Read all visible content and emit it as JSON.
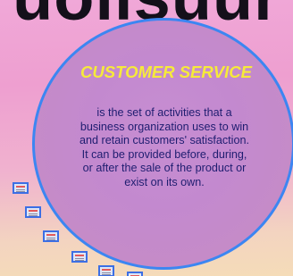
{
  "slide": {
    "heading_partial": "uolisuur",
    "title": "CUSTOMER SERVICE",
    "body_lines": [
      "is the set of activities that a",
      "business organization uses to win",
      "and retain customers' satisfaction.",
      "It can be provided before, during,",
      "or after the sale of the product or",
      "exist on its own."
    ]
  },
  "colors": {
    "circle_border": "#3c86f2",
    "title": "#f6ea3a",
    "body_text": "#1f1d70"
  },
  "icons": [
    "slide-thumbnail-icon"
  ]
}
